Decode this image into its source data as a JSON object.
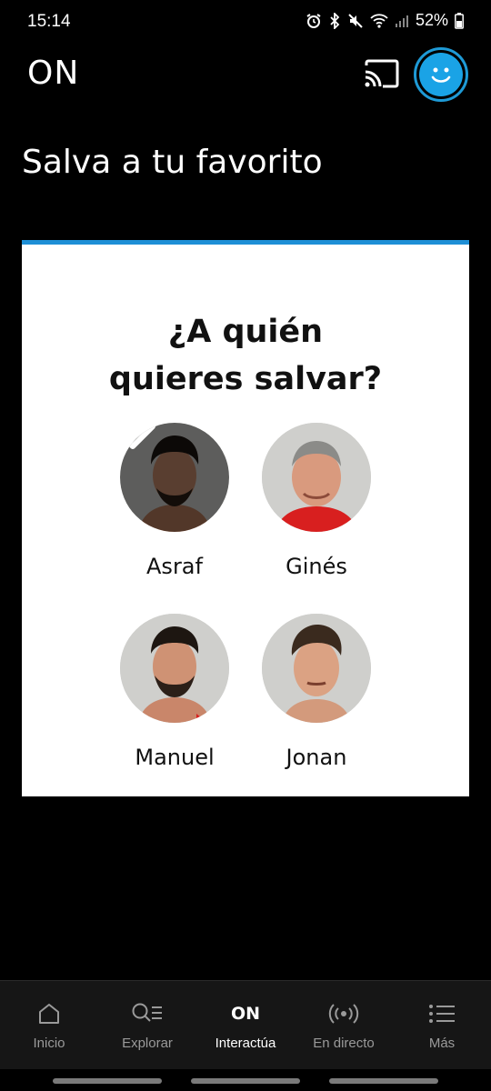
{
  "status_bar": {
    "time": "15:14",
    "battery": "52%"
  },
  "header": {
    "logo": "ON"
  },
  "page": {
    "title": "Salva a tu favorito"
  },
  "vote": {
    "question_line1": "¿A quién",
    "question_line2": "quieres salvar?",
    "candidates": [
      {
        "name": "Asraf",
        "selected": true
      },
      {
        "name": "Ginés",
        "selected": false
      },
      {
        "name": "Manuel",
        "selected": false
      },
      {
        "name": "Jonan",
        "selected": false
      }
    ]
  },
  "nav": {
    "items": [
      {
        "label": "Inicio",
        "icon": "home-icon"
      },
      {
        "label": "Explorar",
        "icon": "search-list-icon"
      },
      {
        "label": "Interactúa",
        "icon": "on-logo-icon",
        "active": true,
        "icon_text": "ON"
      },
      {
        "label": "En directo",
        "icon": "broadcast-icon"
      },
      {
        "label": "Más",
        "icon": "menu-list-icon"
      }
    ]
  },
  "colors": {
    "accent": "#1e8fd6",
    "avatar": "#1aa3e6",
    "background": "#000000",
    "nav_bg": "#161616"
  }
}
